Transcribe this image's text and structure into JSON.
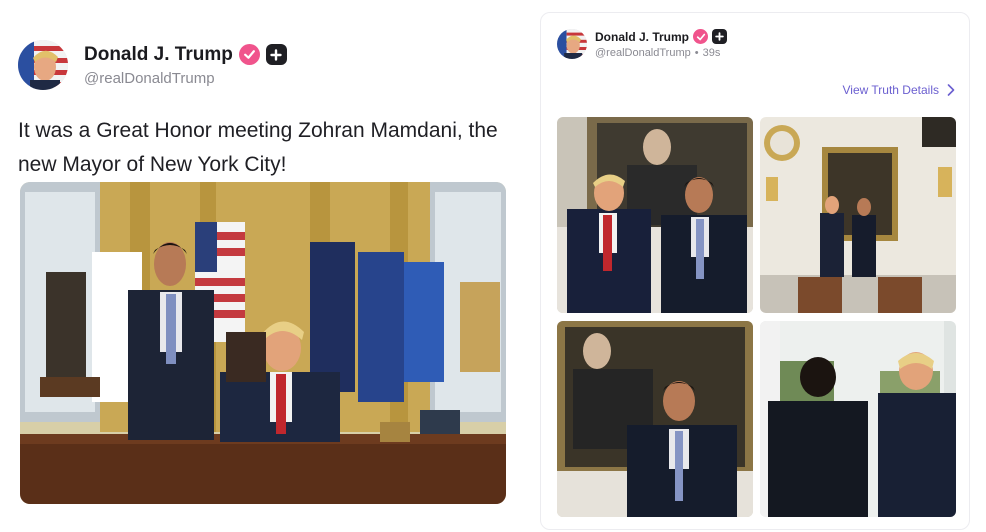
{
  "left_post": {
    "display_name": "Donald J. Trump",
    "handle": "@realDonaldTrump",
    "text": "It was a Great Honor meeting Zohran Mamdani, the new Mayor of New York City!",
    "verified_icon": "verified-check-icon",
    "plus_icon": "plus-badge-icon"
  },
  "right_card": {
    "display_name": "Donald J. Trump",
    "handle": "@realDonaldTrump",
    "separator": "•",
    "time": "39s",
    "view_details_label": "View Truth Details",
    "chevron_icon": "chevron-right-icon"
  },
  "colors": {
    "verified_pink": "#f0548c",
    "link_purple": "#6b5fd0",
    "text_dark": "#1b1b1f",
    "text_muted": "#8a8a92"
  }
}
